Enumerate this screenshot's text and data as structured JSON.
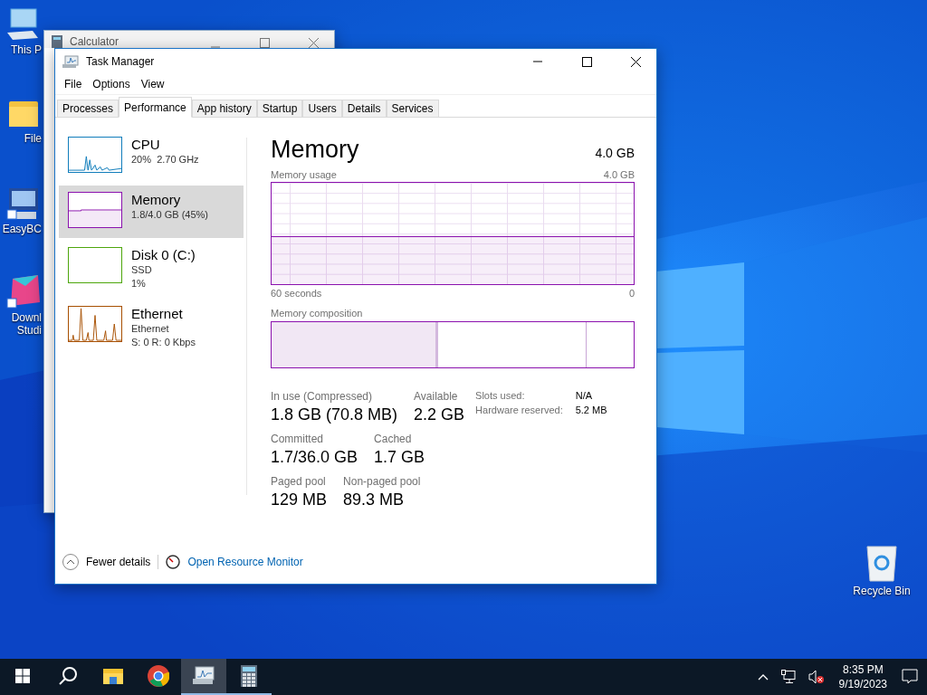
{
  "desktop": {
    "icons": [
      {
        "kind": "computer",
        "lines": [
          "This P"
        ]
      },
      {
        "kind": "folder",
        "lines": [
          "File"
        ]
      },
      {
        "kind": "easybcd",
        "lines": [
          "EasyBC"
        ]
      },
      {
        "kind": "ds",
        "lines": [
          "Downl",
          "Studi"
        ]
      }
    ],
    "recycle_bin": {
      "label": "Recycle Bin"
    }
  },
  "calculator_window": {
    "title": "Calculator"
  },
  "task_manager": {
    "title": "Task Manager",
    "menu": [
      "File",
      "Options",
      "View"
    ],
    "tabs": [
      {
        "label": "Processes",
        "selected": false
      },
      {
        "label": "Performance",
        "selected": true
      },
      {
        "label": "App history",
        "selected": false
      },
      {
        "label": "Startup",
        "selected": false
      },
      {
        "label": "Users",
        "selected": false
      },
      {
        "label": "Details",
        "selected": false
      },
      {
        "label": "Services",
        "selected": false
      }
    ],
    "sidebar": [
      {
        "kind": "cpu",
        "name": "CPU",
        "lines": [
          "20%  2.70 GHz"
        ],
        "color": "#117dbb",
        "selected": false
      },
      {
        "kind": "memory",
        "name": "Memory",
        "lines": [
          "1.8/4.0 GB (45%)"
        ],
        "color": "#8b12ae",
        "selected": true
      },
      {
        "kind": "disk",
        "name": "Disk 0 (C:)",
        "lines": [
          "SSD",
          "1%"
        ],
        "color": "#4da60c",
        "selected": false
      },
      {
        "kind": "ethernet",
        "name": "Ethernet",
        "lines": [
          "Ethernet",
          "S: 0 R: 0 Kbps"
        ],
        "color": "#a74f01",
        "selected": false
      }
    ],
    "panel": {
      "title": "Memory",
      "capacity": "4.0 GB",
      "usage": {
        "label": "Memory usage",
        "max": "4.0 GB",
        "time_span": "60 seconds",
        "min": "0"
      },
      "composition": {
        "label": "Memory composition",
        "segments": [
          {
            "kind": "standby",
            "level": 0.87
          },
          {
            "kind": "in-use",
            "level": 0.46
          }
        ]
      },
      "stats": [
        [
          {
            "label": "In use (Compressed)",
            "value": "1.8 GB (70.8 MB)"
          },
          {
            "label": "Available",
            "value": "2.2 GB"
          }
        ],
        [
          {
            "label": "Committed",
            "value": "1.7/36.0 GB"
          },
          {
            "label": "Cached",
            "value": "1.7 GB"
          }
        ],
        [
          {
            "label": "Paged pool",
            "value": "129 MB"
          },
          {
            "label": "Non-paged pool",
            "value": "89.3 MB"
          }
        ]
      ],
      "details": [
        {
          "label": "Slots used:",
          "value": "N/A"
        },
        {
          "label": "Hardware reserved:",
          "value": "5.2 MB"
        }
      ]
    },
    "footer": {
      "fewer_details": "Fewer details",
      "resource_monitor": "Open Resource Monitor"
    }
  },
  "taskbar": {
    "items": [
      {
        "kind": "start",
        "selected": false,
        "running": false
      },
      {
        "kind": "search",
        "selected": false,
        "running": false
      },
      {
        "kind": "explorer",
        "selected": false,
        "running": false
      },
      {
        "kind": "chrome",
        "selected": false,
        "running": false
      },
      {
        "kind": "taskmgr",
        "selected": true,
        "running": true
      },
      {
        "kind": "calculator",
        "selected": false,
        "running": true
      }
    ],
    "time": "8:35 PM",
    "date": "9/19/2023"
  }
}
